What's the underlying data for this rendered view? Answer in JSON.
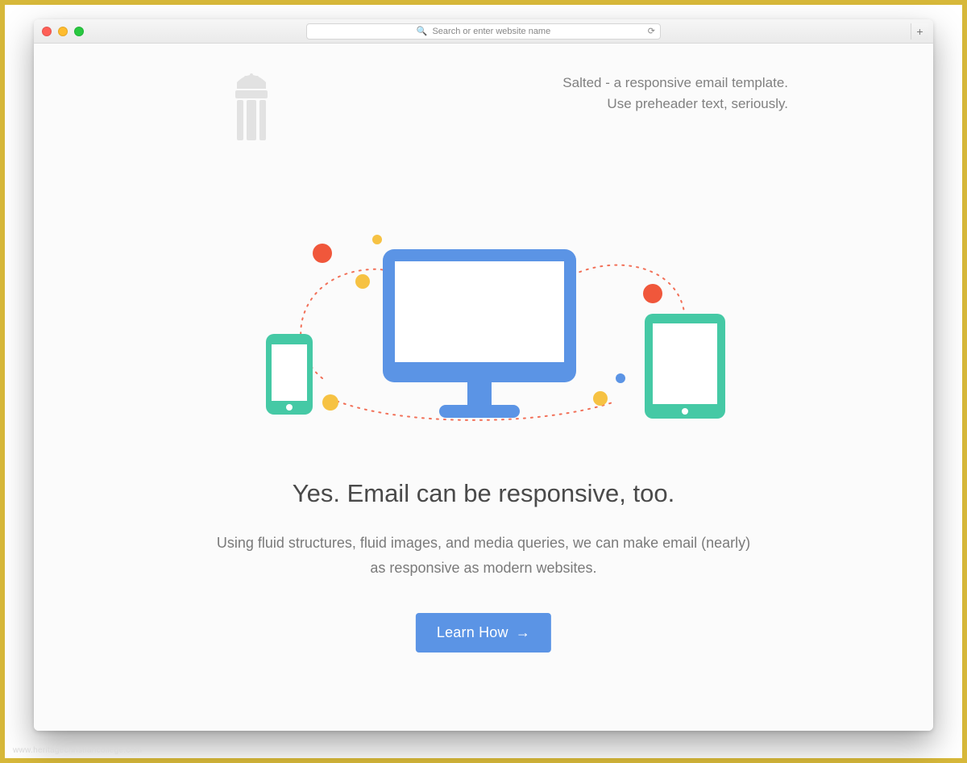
{
  "browser": {
    "address_placeholder": "Search or enter website name"
  },
  "header": {
    "preheader_line1": "Salted - a responsive email template.",
    "preheader_line2": "Use preheader text, seriously."
  },
  "content": {
    "headline": "Yes. Email can be responsive, too.",
    "subhead": "Using fluid structures, fluid images, and media queries, we can make email (nearly) as responsive as modern websites.",
    "cta_label": "Learn How",
    "cta_arrow": "→"
  },
  "illustration": {
    "monitor_color": "#5b94e5",
    "phone_color": "#45c9a5",
    "tablet_color": "#45c9a5",
    "accent_red": "#f0573b",
    "accent_yellow": "#f6c243"
  },
  "footer": {
    "watermark": "www.heritagechristiancollege.com"
  }
}
